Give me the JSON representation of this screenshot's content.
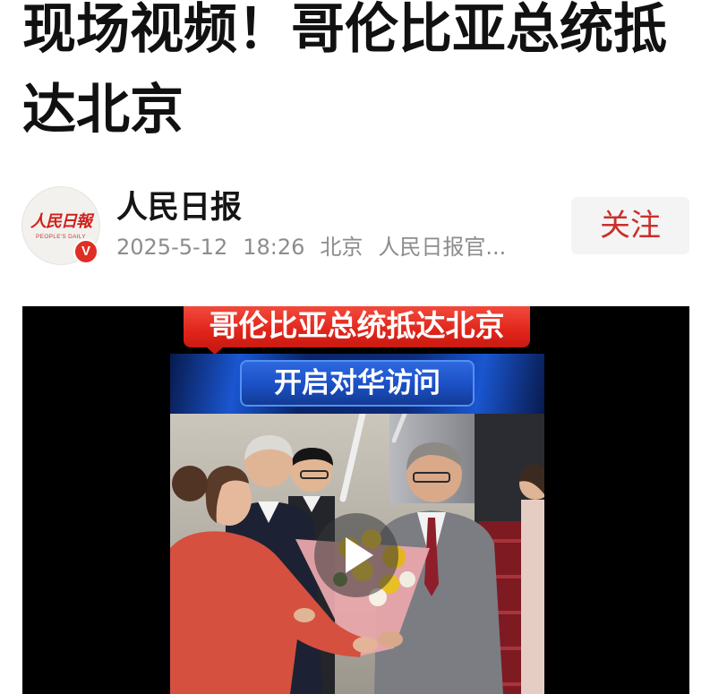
{
  "article": {
    "title": "现场视频！哥伦比亚总统抵达北京"
  },
  "author": {
    "name": "人民日报",
    "avatar": {
      "logo_text": "人民日報",
      "logo_subtext": "PEOPLE'S DAILY",
      "verified_badge": "V",
      "verified_icon": "verified-badge-icon"
    },
    "meta": {
      "date": "2025-5-12",
      "time": "18:26",
      "location": "北京",
      "source": "人民日报官..."
    },
    "follow_label": "关注"
  },
  "video": {
    "banner_title": "哥伦比亚总统抵达北京",
    "banner_subtitle": "开启对华访问",
    "play_icon": "play-icon"
  },
  "colors": {
    "title_text": "#111111",
    "meta_text": "#8c8c8c",
    "follow_text": "#c9302c",
    "follow_bg": "#f4f4f4",
    "verified_badge": "#e02e24",
    "banner_red": "#e1251b",
    "banner_blue": "#1b4fc4",
    "video_bg": "#000000"
  }
}
